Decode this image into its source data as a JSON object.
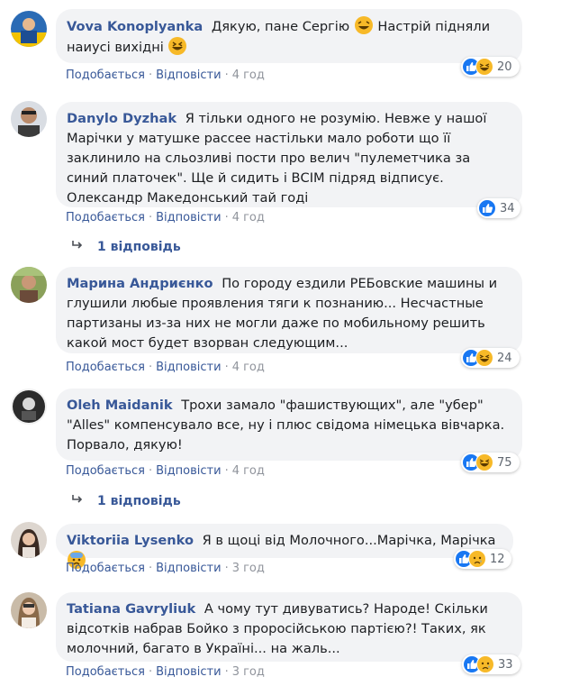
{
  "actions": {
    "like": "Подобається",
    "reply": "Відповісти",
    "sep": "·"
  },
  "colors": {
    "author": "#385898",
    "bubble": "#f2f3f5",
    "like": "#1877f2",
    "haha": "#f7b928"
  },
  "comments": [
    {
      "author": "Vova Konoplyanka",
      "text": "Дякую, пане Сергію 😂 Настрій підняли наиусі вихідні 😆",
      "time": "4 год",
      "reactions": [
        "like",
        "haha"
      ],
      "count": "20"
    },
    {
      "author": "Danylo Dyzhak",
      "text": "Я тільки одного не розумію. Невже у нашої Марічки у матушке рассее настільки мало роботи що її заклинило на сльозливі пости про велич \"пулеметчика за синий платочек\". Ще й сидить і ВСІМ підряд відписує. Олександр Македонський тай годі",
      "time": "4 год",
      "reactions": [
        "like"
      ],
      "count": "34",
      "replies": "1 відповідь"
    },
    {
      "author": "Марина Андриєнко",
      "text": "По городу ездили РЕБовские машины и глушили любые проявления тяги к познанию... Несчастные партизаны из-за них не могли даже по мобильному решить какой мост будет взорван следующим...",
      "time": "4 год",
      "reactions": [
        "like",
        "haha"
      ],
      "count": "24"
    },
    {
      "author": "Oleh Maidanik",
      "text": "Трохи замало \"фашиствующих\", але \"убер\" \"Alles\" компенсувало все, ну і плюс свідома німецька вівчарка. Порвало, дякую!",
      "time": "4 год",
      "reactions": [
        "like",
        "haha"
      ],
      "count": "75",
      "replies": "1 відповідь"
    },
    {
      "author": "Viktoriia Lysenko",
      "text": "Я в щоці від Молочного...Марічка, Марічка 😰",
      "time": "3 год",
      "reactions": [
        "like",
        "sad"
      ],
      "count": "12"
    },
    {
      "author": "Tatiana Gavryliuk",
      "text": "А чому тут дивуватись? Народе! Скільки відсотків набрав Бойко з проросійською партією?! Таких, як молочний, багато в Україні... на жаль...",
      "time": "3 год",
      "reactions": [
        "like",
        "sad"
      ],
      "count": "33"
    }
  ]
}
